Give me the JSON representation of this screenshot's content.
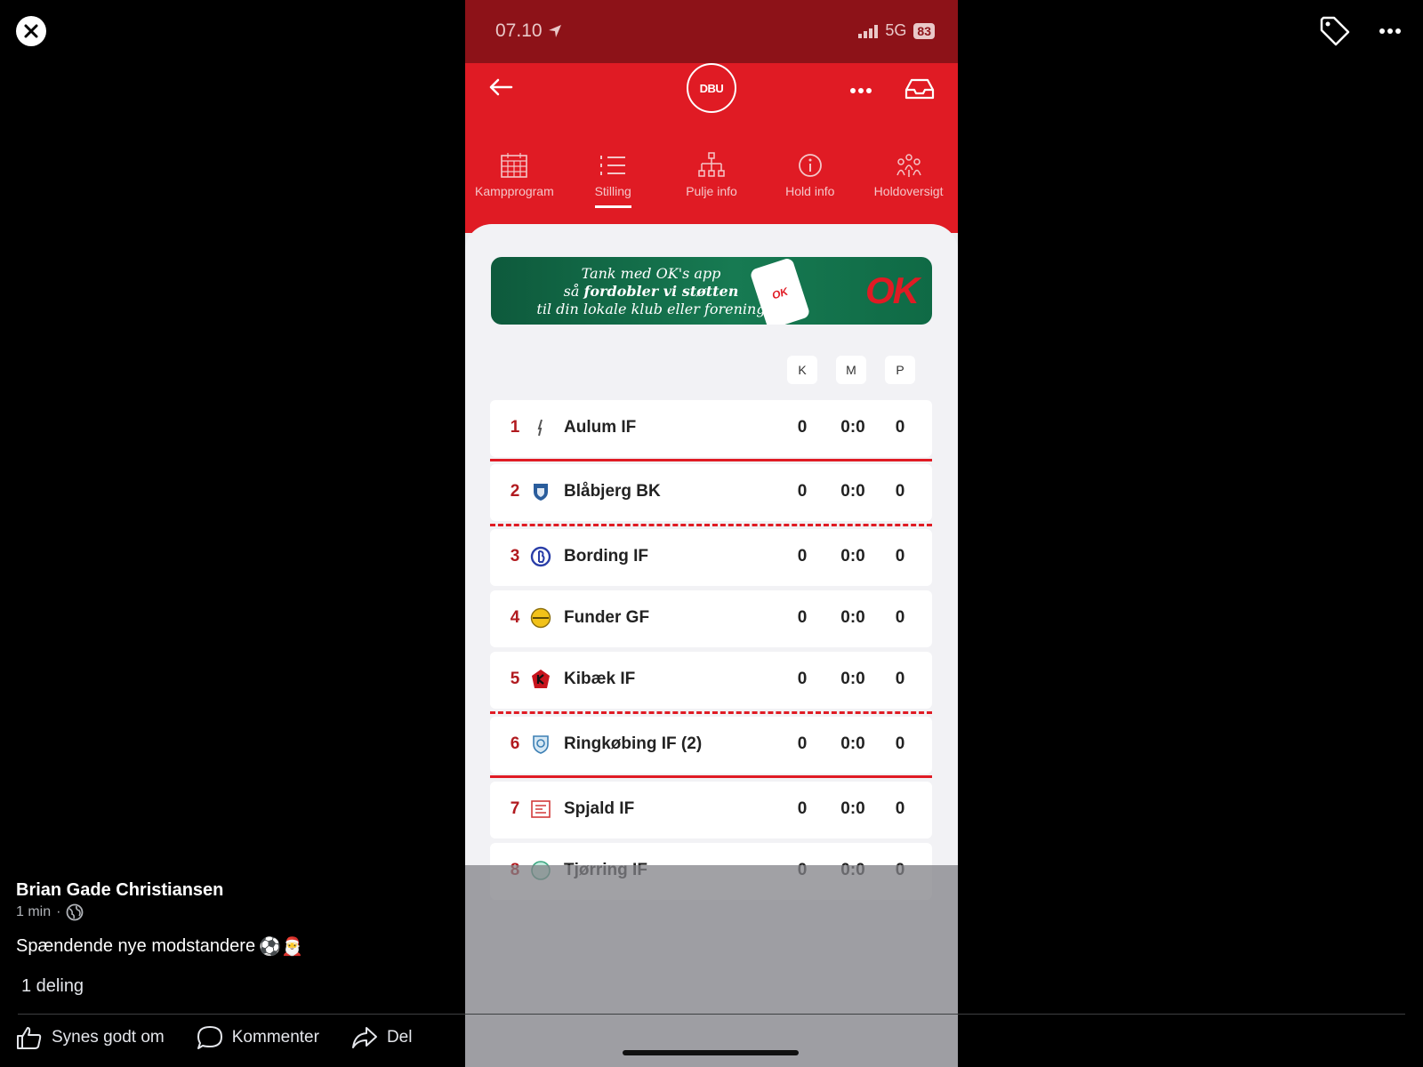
{
  "phone": {
    "status": {
      "time": "07.10",
      "network": "5G",
      "battery": "83"
    },
    "tabs": [
      {
        "label": "Kampprogram",
        "icon": "calendar-icon"
      },
      {
        "label": "Stilling",
        "icon": "list-icon",
        "active": true
      },
      {
        "label": "Pulje info",
        "icon": "bracket-icon"
      },
      {
        "label": "Hold info",
        "icon": "info-icon"
      },
      {
        "label": "Holdoversigt",
        "icon": "team-icon"
      }
    ],
    "logo_text": "DBU",
    "ad": {
      "line1": "Tank med OK's app",
      "line2_prefix": "så ",
      "line2_bold": "fordobler vi støtten",
      "line3": "til din lokale klub eller forening",
      "phone_logo": "OK",
      "logo": "OK"
    },
    "columns": {
      "k": "K",
      "m": "M",
      "p": "P"
    },
    "standings": [
      {
        "pos": "1",
        "team": "Aulum IF",
        "k": "0",
        "m": "0:0",
        "p": "0"
      },
      {
        "pos": "2",
        "team": "Blåbjerg BK",
        "k": "0",
        "m": "0:0",
        "p": "0"
      },
      {
        "pos": "3",
        "team": "Bording IF",
        "k": "0",
        "m": "0:0",
        "p": "0"
      },
      {
        "pos": "4",
        "team": "Funder GF",
        "k": "0",
        "m": "0:0",
        "p": "0"
      },
      {
        "pos": "5",
        "team": "Kibæk IF",
        "k": "0",
        "m": "0:0",
        "p": "0"
      },
      {
        "pos": "6",
        "team": "Ringkøbing IF  (2)",
        "k": "0",
        "m": "0:0",
        "p": "0"
      },
      {
        "pos": "7",
        "team": "Spjald IF",
        "k": "0",
        "m": "0:0",
        "p": "0"
      },
      {
        "pos": "8",
        "team": "Tjørring IF",
        "k": "0",
        "m": "0:0",
        "p": "0"
      }
    ]
  },
  "post": {
    "author": "Brian Gade Christiansen",
    "time": "1 min",
    "separator": "·",
    "caption": "Spændende nye modstandere",
    "caption_emoji": "⚽🎅",
    "shares": "1 deling",
    "actions": {
      "like": "Synes godt om",
      "comment": "Kommenter",
      "share": "Del"
    }
  }
}
